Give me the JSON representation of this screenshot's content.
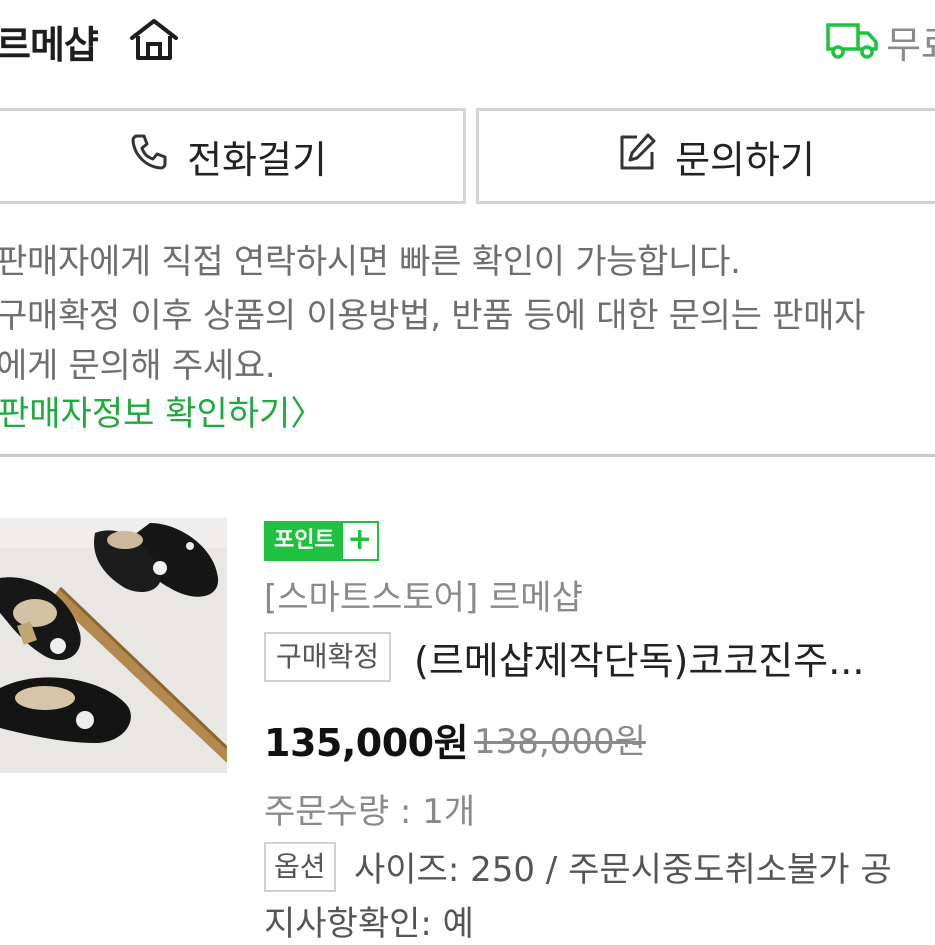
{
  "header": {
    "store_name": "르메샵",
    "home_icon": "home-icon",
    "truck_icon": "truck-icon",
    "shipping_label": "무료"
  },
  "buttons": {
    "call_label": "전화걸기",
    "call_icon": "phone-icon",
    "inquiry_label": "문의하기",
    "inquiry_icon": "edit-icon"
  },
  "notice": {
    "line1": "판매자에게 직접 연락하시면 빠른 확인이 가능합니다.",
    "line2": "구매확정 이후 상품의 이용방법, 반품 등에 대한 문의는 판매자",
    "line3": "에게 문의해 주세요.",
    "seller_info_link": "판매자정보 확인하기",
    "link_chevron": "〉"
  },
  "product": {
    "point_badge": "포인트",
    "point_plus": "+",
    "store_tag": "[스마트스토어] 르메샵",
    "status_badge": "구매확정",
    "title": "(르메샵제작단독)코코진주...",
    "sale_price": "135,000원",
    "original_price": "138,000원",
    "quantity": "주문수량 : 1개",
    "option_badge": "옵션",
    "option_line1": "사이즈: 250 / 주문시중도취소불가 공",
    "option_line2": "지사항확인: 예"
  },
  "colors": {
    "accent_green": "#1eaa3c",
    "badge_green": "#1ec23e",
    "border_gray": "#d4d4d4",
    "muted_text": "#8a8a8a"
  }
}
